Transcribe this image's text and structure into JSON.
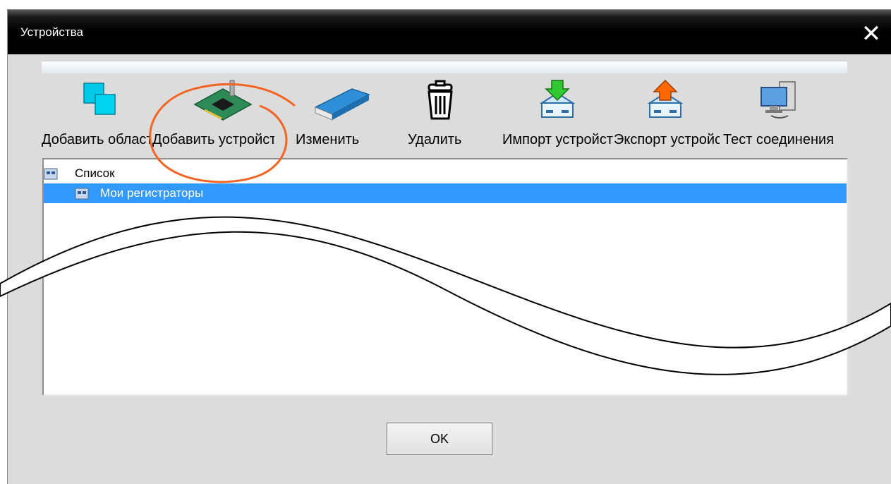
{
  "window": {
    "title": "Устройства",
    "close_glyph": "✕"
  },
  "toolbar": {
    "items": [
      {
        "label": "Добавить область",
        "icon": "add-area-icon"
      },
      {
        "label": "Добавить устройство",
        "icon": "network-card-icon"
      },
      {
        "label": "Изменить",
        "icon": "edit-eraser-icon"
      },
      {
        "label": "Удалить",
        "icon": "trash-icon"
      },
      {
        "label": "Импорт устройств",
        "icon": "import-icon"
      },
      {
        "label": "Экспорт устройств",
        "icon": "export-icon"
      },
      {
        "label": "Тест соединения",
        "icon": "connection-test-icon"
      }
    ]
  },
  "tree": {
    "root": {
      "label": "Список",
      "icon": "folder-devices-icon"
    },
    "children": [
      {
        "label": "Мои регистраторы",
        "icon": "folder-devices-icon",
        "selected": true
      }
    ]
  },
  "buttons": {
    "ok_label": "OK"
  },
  "colors": {
    "selection": "#3399ff",
    "annotation": "#f26522",
    "titlebar": "#000000"
  }
}
